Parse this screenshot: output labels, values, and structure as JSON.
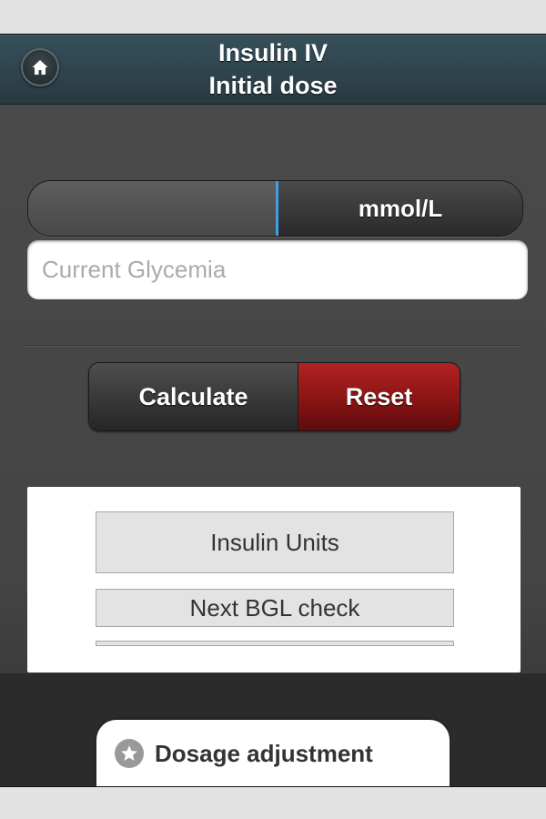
{
  "header": {
    "title_line1": "Insulin IV",
    "title_line2": "Initial dose",
    "home_icon": "home-icon"
  },
  "unit_toggle": {
    "left_label": "",
    "right_label": "mmol/L",
    "selected": "left"
  },
  "glycemia_input": {
    "placeholder": "Current Glycemia",
    "value": ""
  },
  "actions": {
    "calculate_label": "Calculate",
    "reset_label": "Reset",
    "reset_color": "#9b1a1a"
  },
  "results": {
    "insulin_units_label": "Insulin Units",
    "next_bgl_label": "Next BGL check",
    "third_label": ""
  },
  "footer": {
    "dosage_label": "Dosage adjustment",
    "dosage_icon": "star-icon"
  }
}
